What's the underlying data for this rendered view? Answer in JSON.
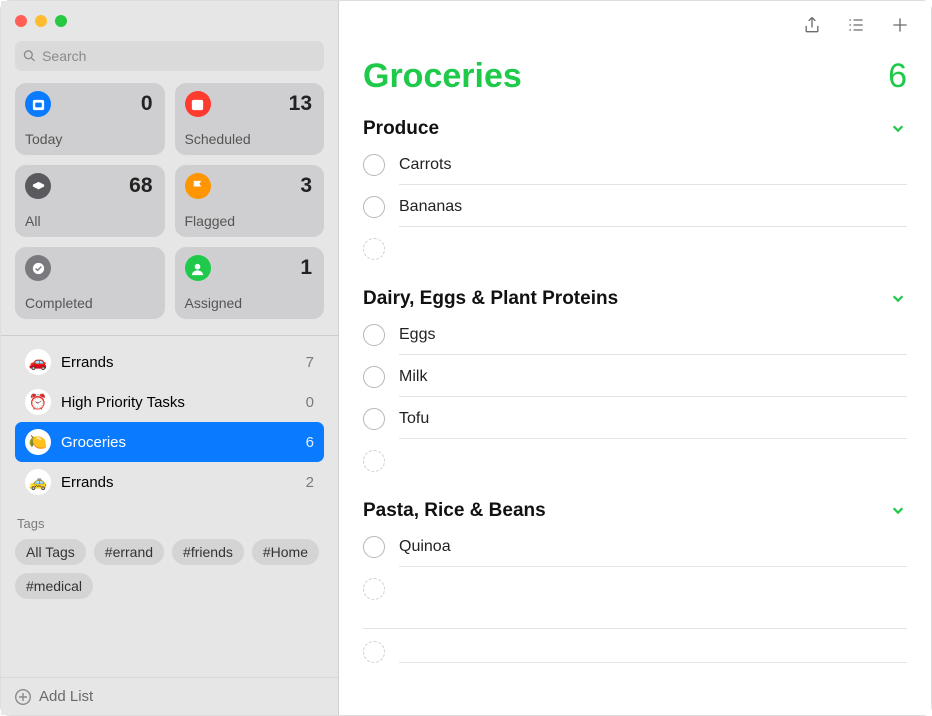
{
  "search": {
    "placeholder": "Search"
  },
  "smart_lists": [
    {
      "key": "today",
      "label": "Today",
      "count": 0,
      "color": "#0a7bff"
    },
    {
      "key": "scheduled",
      "label": "Scheduled",
      "count": 13,
      "color": "#ff3b30"
    },
    {
      "key": "all",
      "label": "All",
      "count": 68,
      "color": "#5a5a5e"
    },
    {
      "key": "flagged",
      "label": "Flagged",
      "count": 3,
      "color": "#ff9500"
    },
    {
      "key": "completed",
      "label": "Completed",
      "count": "",
      "color": "#7a7a7e"
    },
    {
      "key": "assigned",
      "label": "Assigned",
      "count": 1,
      "color": "#1fc94a"
    }
  ],
  "user_lists": [
    {
      "name": "Errands",
      "count": 7,
      "emoji": "🚗",
      "selected": false
    },
    {
      "name": "High Priority Tasks",
      "count": 0,
      "emoji": "⏰",
      "selected": false
    },
    {
      "name": "Groceries",
      "count": 6,
      "emoji": "🍋",
      "selected": true
    },
    {
      "name": "Errands",
      "count": 2,
      "emoji": "🚕",
      "selected": false
    }
  ],
  "tags_label": "Tags",
  "tags": [
    "All Tags",
    "#errand",
    "#friends",
    "#Home",
    "#medical"
  ],
  "add_list_label": "Add List",
  "main": {
    "title": "Groceries",
    "count": 6,
    "accent": "#1fc94a",
    "sections": [
      {
        "title": "Produce",
        "items": [
          "Carrots",
          "Bananas"
        ]
      },
      {
        "title": "Dairy, Eggs & Plant Proteins",
        "items": [
          "Eggs",
          "Milk",
          "Tofu"
        ]
      },
      {
        "title": "Pasta, Rice & Beans",
        "items": [
          "Quinoa"
        ]
      }
    ]
  }
}
